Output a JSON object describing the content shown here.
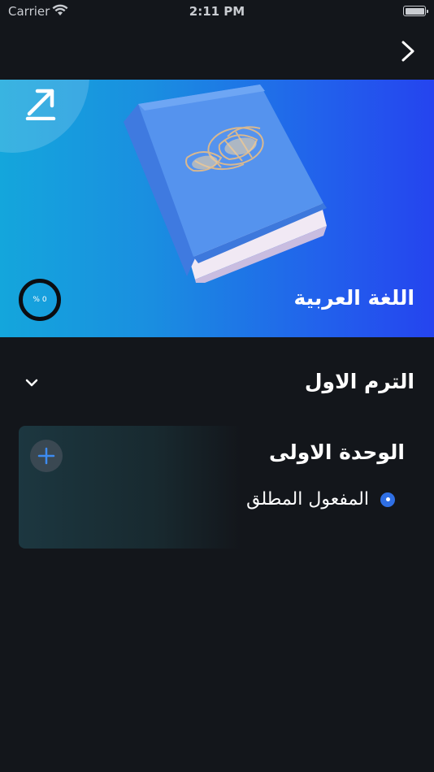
{
  "status_bar": {
    "carrier": "Carrier",
    "time": "2:11 PM"
  },
  "nav": {
    "forward_icon": "chevron-right-icon"
  },
  "hero": {
    "title": "اللغة العربية",
    "progress_text": "% 0",
    "progress_value": 0,
    "share_icon": "arrow-up-right-icon",
    "image": "book-illustration",
    "colors": {
      "gradient_start": "#14a6dc",
      "gradient_end": "#2544ef"
    }
  },
  "term": {
    "title": "الترم الاول",
    "toggle_icon": "chevron-down-icon"
  },
  "unit": {
    "title": "الوحدة الاولى",
    "add_icon": "plus-icon",
    "lessons": [
      {
        "label": "المفعول المطلق",
        "icon": "radio-dot-icon"
      }
    ]
  },
  "colors": {
    "background": "#13161b",
    "accent": "#2f6fe4"
  }
}
